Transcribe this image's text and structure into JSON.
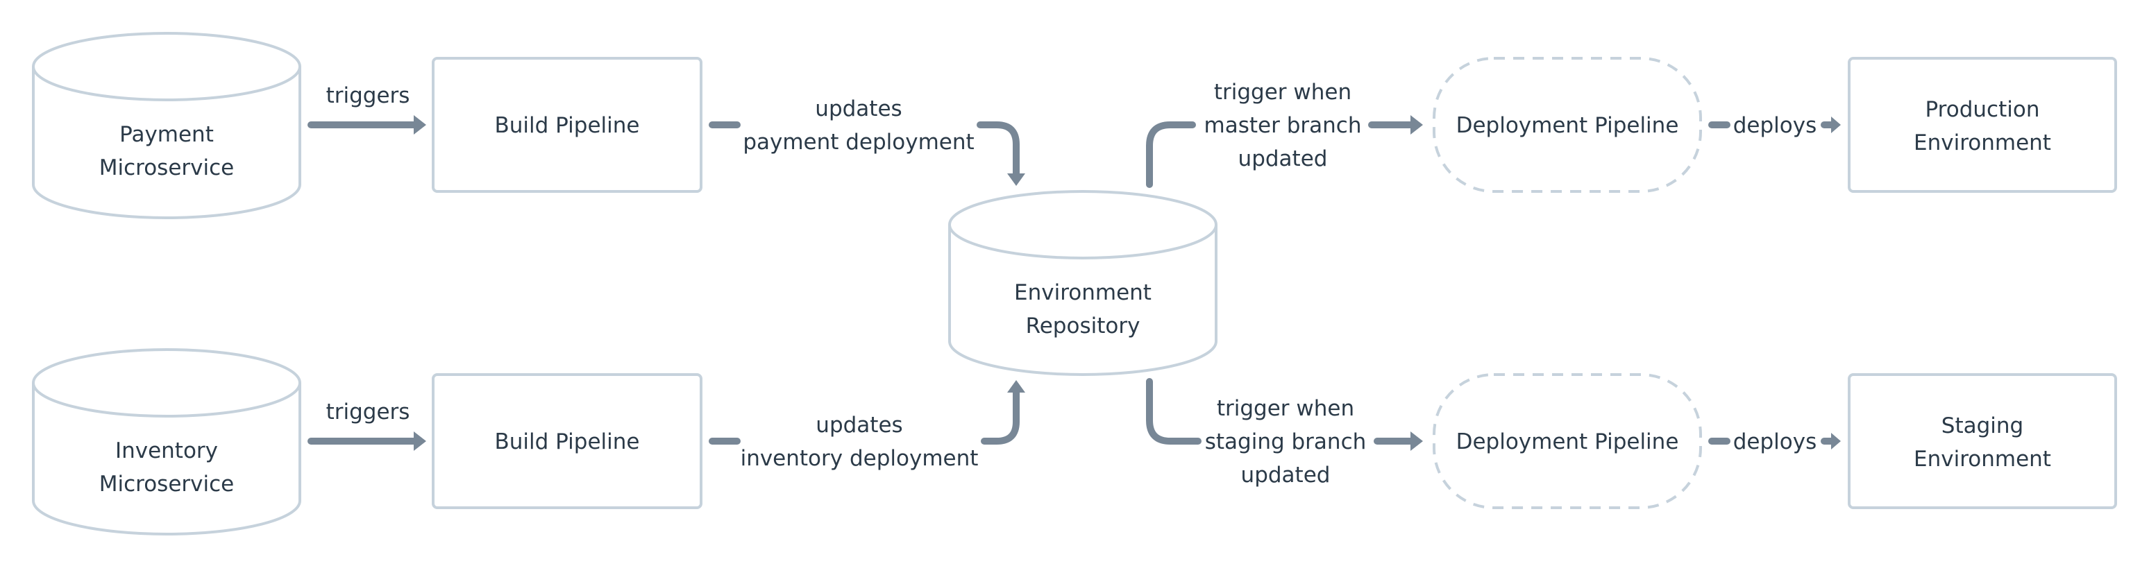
{
  "diagram": {
    "type": "gitops-pipeline-flow",
    "colors": {
      "node_border": "#c6d2dc",
      "edge": "#788796",
      "text": "#2b3a48",
      "background": "#ffffff"
    },
    "nodes": {
      "payment_service": {
        "shape": "cylinder",
        "lines": [
          "Payment",
          "Microservice"
        ]
      },
      "inventory_service": {
        "shape": "cylinder",
        "lines": [
          "Inventory",
          "Microservice"
        ]
      },
      "build_payment": {
        "shape": "rectangle",
        "lines": [
          "Build Pipeline"
        ]
      },
      "build_inventory": {
        "shape": "rectangle",
        "lines": [
          "Build Pipeline"
        ]
      },
      "env_repo": {
        "shape": "cylinder",
        "lines": [
          "Environment",
          "Repository"
        ]
      },
      "deploy_master": {
        "shape": "dashed-rounded",
        "lines": [
          "Deployment Pipeline"
        ]
      },
      "deploy_staging": {
        "shape": "dashed-rounded",
        "lines": [
          "Deployment Pipeline"
        ]
      },
      "prod_env": {
        "shape": "rectangle",
        "lines": [
          "Production",
          "Environment"
        ]
      },
      "staging_env": {
        "shape": "rectangle",
        "lines": [
          "Staging",
          "Environment"
        ]
      }
    },
    "edges": {
      "payment_to_build": {
        "from": "payment_service",
        "to": "build_payment",
        "lines": [
          "triggers"
        ]
      },
      "inventory_to_build": {
        "from": "inventory_service",
        "to": "build_inventory",
        "lines": [
          "triggers"
        ]
      },
      "build_payment_to_repo": {
        "from": "build_payment",
        "to": "env_repo",
        "lines": [
          "updates",
          "payment deployment"
        ]
      },
      "build_inventory_to_repo": {
        "from": "build_inventory",
        "to": "env_repo",
        "lines": [
          "updates",
          "inventory deployment"
        ]
      },
      "repo_to_deploy_master": {
        "from": "env_repo",
        "to": "deploy_master",
        "lines": [
          "trigger when",
          "master branch",
          "updated"
        ]
      },
      "repo_to_deploy_staging": {
        "from": "env_repo",
        "to": "deploy_staging",
        "lines": [
          "trigger when",
          "staging branch",
          "updated"
        ]
      },
      "deploy_master_to_prod": {
        "from": "deploy_master",
        "to": "prod_env",
        "lines": [
          "deploys"
        ]
      },
      "deploy_staging_to_staging": {
        "from": "deploy_staging",
        "to": "staging_env",
        "lines": [
          "deploys"
        ]
      }
    }
  }
}
